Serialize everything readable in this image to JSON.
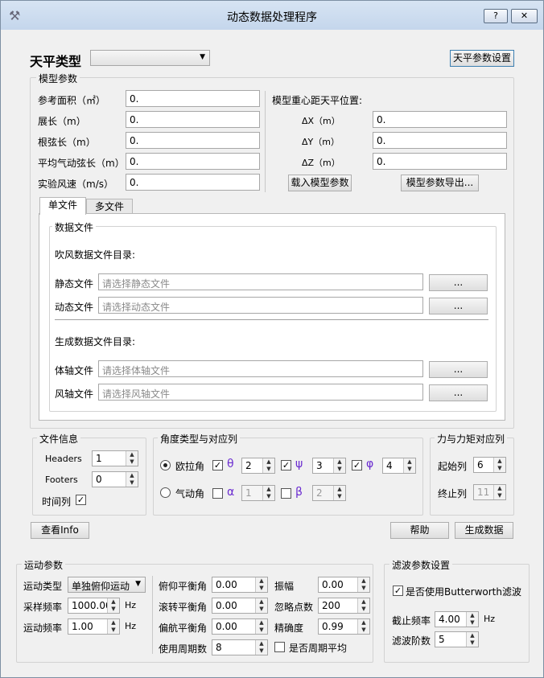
{
  "window": {
    "title": "动态数据处理程序",
    "help_btn": "?",
    "close_btn": "✕"
  },
  "balance": {
    "label": "天平类型",
    "combo_value": "",
    "settings_btn": "天平参数设置"
  },
  "model": {
    "group_title": "模型参数",
    "ref_area_label": "参考面积（㎡）",
    "ref_area_value": "0.",
    "span_label": "展长（m）",
    "span_value": "0.",
    "root_chord_label": "根弦长（m）",
    "root_chord_value": "0.",
    "mac_label": "平均气动弦长（m）",
    "mac_value": "0.",
    "wind_speed_label": "实验风速（m/s）",
    "wind_speed_value": "0.",
    "cg_title": "模型重心距天平位置:",
    "dx_label": "ΔX（m）",
    "dx_value": "0.",
    "dy_label": "ΔY（m）",
    "dy_value": "0.",
    "dz_label": "ΔZ（m）",
    "dz_value": "0.",
    "load_btn": "载入模型参数",
    "export_btn": "模型参数导出..."
  },
  "tabs": {
    "single": "单文件",
    "multi": "多文件"
  },
  "datafiles": {
    "group_title": "数据文件",
    "blow_dir_label": "吹风数据文件目录:",
    "static_label": "静态文件",
    "static_placeholder": "请选择静态文件",
    "dynamic_label": "动态文件",
    "dynamic_placeholder": "请选择动态文件",
    "gen_dir_label": "生成数据文件目录:",
    "body_label": "体轴文件",
    "body_placeholder": "请选择体轴文件",
    "wind_label": "风轴文件",
    "wind_placeholder": "请选择风轴文件",
    "browse": "..."
  },
  "fileinfo": {
    "group_title": "文件信息",
    "headers_label": "Headers",
    "headers_value": "1",
    "footers_label": "Footers",
    "footers_value": "0",
    "time_col_label": "时间列",
    "time_col_checked": true
  },
  "angles": {
    "group_title": "角度类型与对应列",
    "euler_label": "欧拉角",
    "aero_label": "气动角",
    "theta": "θ",
    "psi": "ψ",
    "phi": "φ",
    "alpha": "α",
    "beta": "β",
    "theta_col": "2",
    "psi_col": "3",
    "phi_col": "4",
    "alpha_col": "1",
    "beta_col": "2"
  },
  "forces": {
    "group_title": "力与力矩对应列",
    "start_label": "起始列",
    "start_value": "6",
    "end_label": "终止列",
    "end_value": "11"
  },
  "actions": {
    "view_info": "查看Info",
    "help": "帮助",
    "generate": "生成数据"
  },
  "motion": {
    "group_title": "运动参数",
    "type_label": "运动类型",
    "type_value": "单独俯仰运动",
    "sample_rate_label": "采样频率",
    "sample_rate_value": "1000.00",
    "hz": "Hz",
    "motion_freq_label": "运动频率",
    "motion_freq_value": "1.00",
    "pitch_bal_label": "俯仰平衡角",
    "pitch_bal_value": "0.00",
    "roll_bal_label": "滚转平衡角",
    "roll_bal_value": "0.00",
    "yaw_bal_label": "偏航平衡角",
    "yaw_bal_value": "0.00",
    "amp_label": "振幅",
    "amp_value": "0.00",
    "ignore_label": "忽略点数",
    "ignore_value": "200",
    "precision_label": "精确度",
    "precision_value": "0.99",
    "periods_label": "使用周期数",
    "periods_value": "8",
    "period_avg_label": "是否周期平均"
  },
  "filter": {
    "group_title": "滤波参数设置",
    "use_bw_label": "是否使用Butterworth滤波",
    "cutoff_label": "截止频率",
    "cutoff_value": "4.00",
    "hz": "Hz",
    "order_label": "滤波阶数",
    "order_value": "5"
  }
}
